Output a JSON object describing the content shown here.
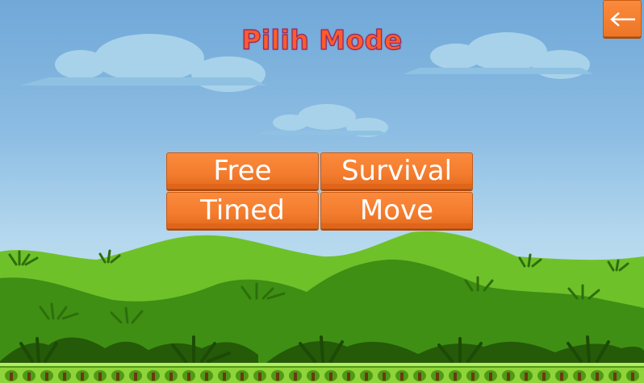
{
  "screen": {
    "title": "Pilih Mode"
  },
  "modes": [
    {
      "label": "Free"
    },
    {
      "label": "Survival"
    },
    {
      "label": "Timed"
    },
    {
      "label": "Move"
    }
  ],
  "back_button": {
    "icon": "back-arrow-icon"
  },
  "colors": {
    "sky_top": "#70a8d8",
    "sky_bottom": "#cfe7f3",
    "button_orange": "#f47d2f",
    "title_orange": "#ff5b2a",
    "title_outline": "#8a2a6a",
    "hill_light": "#6fc12a",
    "hill_dark": "#3f8f14",
    "grass_strip": "#8fd43a"
  }
}
